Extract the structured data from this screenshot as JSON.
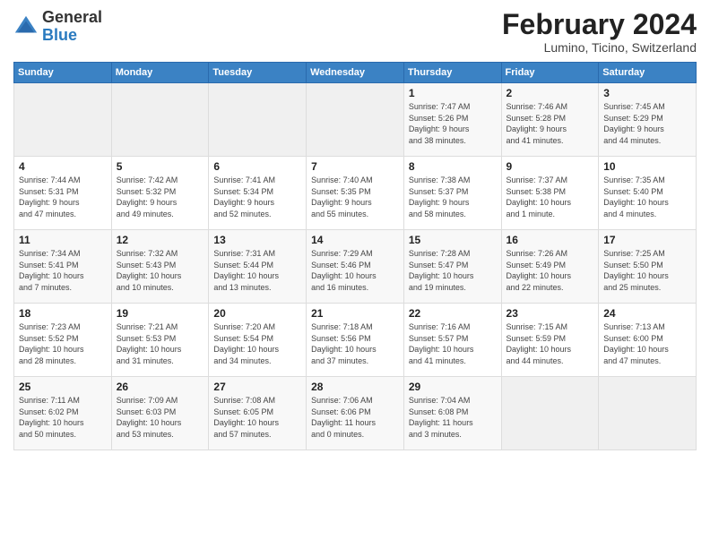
{
  "header": {
    "logo_general": "General",
    "logo_blue": "Blue",
    "month_year": "February 2024",
    "location": "Lumino, Ticino, Switzerland"
  },
  "weekdays": [
    "Sunday",
    "Monday",
    "Tuesday",
    "Wednesday",
    "Thursday",
    "Friday",
    "Saturday"
  ],
  "weeks": [
    [
      {
        "day": "",
        "info": ""
      },
      {
        "day": "",
        "info": ""
      },
      {
        "day": "",
        "info": ""
      },
      {
        "day": "",
        "info": ""
      },
      {
        "day": "1",
        "info": "Sunrise: 7:47 AM\nSunset: 5:26 PM\nDaylight: 9 hours\nand 38 minutes."
      },
      {
        "day": "2",
        "info": "Sunrise: 7:46 AM\nSunset: 5:28 PM\nDaylight: 9 hours\nand 41 minutes."
      },
      {
        "day": "3",
        "info": "Sunrise: 7:45 AM\nSunset: 5:29 PM\nDaylight: 9 hours\nand 44 minutes."
      }
    ],
    [
      {
        "day": "4",
        "info": "Sunrise: 7:44 AM\nSunset: 5:31 PM\nDaylight: 9 hours\nand 47 minutes."
      },
      {
        "day": "5",
        "info": "Sunrise: 7:42 AM\nSunset: 5:32 PM\nDaylight: 9 hours\nand 49 minutes."
      },
      {
        "day": "6",
        "info": "Sunrise: 7:41 AM\nSunset: 5:34 PM\nDaylight: 9 hours\nand 52 minutes."
      },
      {
        "day": "7",
        "info": "Sunrise: 7:40 AM\nSunset: 5:35 PM\nDaylight: 9 hours\nand 55 minutes."
      },
      {
        "day": "8",
        "info": "Sunrise: 7:38 AM\nSunset: 5:37 PM\nDaylight: 9 hours\nand 58 minutes."
      },
      {
        "day": "9",
        "info": "Sunrise: 7:37 AM\nSunset: 5:38 PM\nDaylight: 10 hours\nand 1 minute."
      },
      {
        "day": "10",
        "info": "Sunrise: 7:35 AM\nSunset: 5:40 PM\nDaylight: 10 hours\nand 4 minutes."
      }
    ],
    [
      {
        "day": "11",
        "info": "Sunrise: 7:34 AM\nSunset: 5:41 PM\nDaylight: 10 hours\nand 7 minutes."
      },
      {
        "day": "12",
        "info": "Sunrise: 7:32 AM\nSunset: 5:43 PM\nDaylight: 10 hours\nand 10 minutes."
      },
      {
        "day": "13",
        "info": "Sunrise: 7:31 AM\nSunset: 5:44 PM\nDaylight: 10 hours\nand 13 minutes."
      },
      {
        "day": "14",
        "info": "Sunrise: 7:29 AM\nSunset: 5:46 PM\nDaylight: 10 hours\nand 16 minutes."
      },
      {
        "day": "15",
        "info": "Sunrise: 7:28 AM\nSunset: 5:47 PM\nDaylight: 10 hours\nand 19 minutes."
      },
      {
        "day": "16",
        "info": "Sunrise: 7:26 AM\nSunset: 5:49 PM\nDaylight: 10 hours\nand 22 minutes."
      },
      {
        "day": "17",
        "info": "Sunrise: 7:25 AM\nSunset: 5:50 PM\nDaylight: 10 hours\nand 25 minutes."
      }
    ],
    [
      {
        "day": "18",
        "info": "Sunrise: 7:23 AM\nSunset: 5:52 PM\nDaylight: 10 hours\nand 28 minutes."
      },
      {
        "day": "19",
        "info": "Sunrise: 7:21 AM\nSunset: 5:53 PM\nDaylight: 10 hours\nand 31 minutes."
      },
      {
        "day": "20",
        "info": "Sunrise: 7:20 AM\nSunset: 5:54 PM\nDaylight: 10 hours\nand 34 minutes."
      },
      {
        "day": "21",
        "info": "Sunrise: 7:18 AM\nSunset: 5:56 PM\nDaylight: 10 hours\nand 37 minutes."
      },
      {
        "day": "22",
        "info": "Sunrise: 7:16 AM\nSunset: 5:57 PM\nDaylight: 10 hours\nand 41 minutes."
      },
      {
        "day": "23",
        "info": "Sunrise: 7:15 AM\nSunset: 5:59 PM\nDaylight: 10 hours\nand 44 minutes."
      },
      {
        "day": "24",
        "info": "Sunrise: 7:13 AM\nSunset: 6:00 PM\nDaylight: 10 hours\nand 47 minutes."
      }
    ],
    [
      {
        "day": "25",
        "info": "Sunrise: 7:11 AM\nSunset: 6:02 PM\nDaylight: 10 hours\nand 50 minutes."
      },
      {
        "day": "26",
        "info": "Sunrise: 7:09 AM\nSunset: 6:03 PM\nDaylight: 10 hours\nand 53 minutes."
      },
      {
        "day": "27",
        "info": "Sunrise: 7:08 AM\nSunset: 6:05 PM\nDaylight: 10 hours\nand 57 minutes."
      },
      {
        "day": "28",
        "info": "Sunrise: 7:06 AM\nSunset: 6:06 PM\nDaylight: 11 hours\nand 0 minutes."
      },
      {
        "day": "29",
        "info": "Sunrise: 7:04 AM\nSunset: 6:08 PM\nDaylight: 11 hours\nand 3 minutes."
      },
      {
        "day": "",
        "info": ""
      },
      {
        "day": "",
        "info": ""
      }
    ]
  ]
}
